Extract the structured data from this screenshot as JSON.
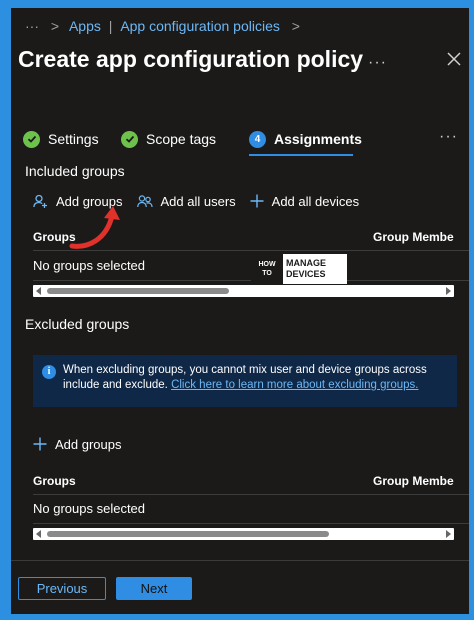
{
  "breadcrumb": {
    "more": "···",
    "items": [
      "Apps",
      "App configuration policies"
    ],
    "separator": "|",
    "trailing": ">"
  },
  "title": "Create app configuration policy",
  "title_more": "···",
  "tabs": [
    {
      "label": "Settings",
      "state": "complete"
    },
    {
      "label": "Scope tags",
      "state": "complete"
    },
    {
      "label": "Assignments",
      "state": "active",
      "step": "4"
    }
  ],
  "tabs_more": "···",
  "included": {
    "heading": "Included groups",
    "actions": {
      "add_groups": "Add groups",
      "add_all_users": "Add all users",
      "add_all_devices": "Add all devices"
    },
    "columns": [
      "Groups",
      "Group Membe"
    ],
    "empty": "No groups selected"
  },
  "excluded": {
    "heading": "Excluded groups",
    "info_text": "When excluding groups, you cannot mix user and device groups across include and exclude.",
    "info_link": "Click here to learn more about excluding groups.",
    "info_icon": "i",
    "add_groups": "Add groups",
    "columns": [
      "Groups",
      "Group Membe"
    ],
    "empty": "No groups selected"
  },
  "watermark": {
    "left": [
      "HOW",
      "TO"
    ],
    "right": [
      "MANAGE",
      "DEVICES"
    ]
  },
  "footer": {
    "previous": "Previous",
    "next": "Next"
  },
  "colors": {
    "accent": "#2f8de4",
    "link": "#6cb8f6",
    "success": "#6cc24a",
    "background": "#1b1a19",
    "annotation_arrow": "#e0312b"
  }
}
